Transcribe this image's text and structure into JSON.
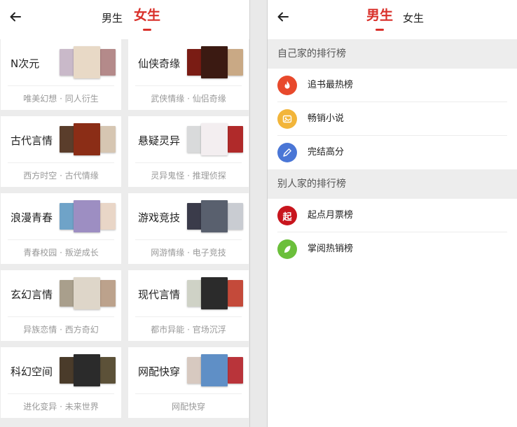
{
  "left": {
    "tabs": {
      "male": "男生",
      "female": "女生"
    },
    "categories": [
      {
        "name": "N次元",
        "tags": "唯美幻想 · 同人衍生",
        "covers": [
          "#c9b9c9",
          "#e8d9c6",
          "#b48a8a"
        ]
      },
      {
        "name": "仙侠奇缘",
        "tags": "武侠情缘 · 仙侣奇缘",
        "covers": [
          "#7a1c14",
          "#3b1a12",
          "#c9a985"
        ]
      },
      {
        "name": "古代言情",
        "tags": "西方时空 · 古代情缘",
        "covers": [
          "#5a3d2b",
          "#8b2d16",
          "#d6c6b2"
        ]
      },
      {
        "name": "悬疑灵异",
        "tags": "灵异鬼怪 · 推理侦探",
        "covers": [
          "#d9dadb",
          "#f3eef0",
          "#b02a2a"
        ]
      },
      {
        "name": "浪漫青春",
        "tags": "青春校园 · 叛逆成长",
        "covers": [
          "#6fa3c8",
          "#9d8ec2",
          "#e9d6c7"
        ]
      },
      {
        "name": "游戏竞技",
        "tags": "网游情缘 · 电子竞技",
        "covers": [
          "#3a3b4a",
          "#59606e",
          "#c9ccd2"
        ]
      },
      {
        "name": "玄幻言情",
        "tags": "异族恋情 · 西方奇幻",
        "covers": [
          "#a99f8c",
          "#ded6c9",
          "#bca28c"
        ]
      },
      {
        "name": "现代言情",
        "tags": "都市异能 · 官场沉浮",
        "covers": [
          "#cfd2c6",
          "#2b2b2b",
          "#c44a3a"
        ]
      },
      {
        "name": "科幻空间",
        "tags": "进化变异 · 未来世界",
        "covers": [
          "#4a3b2a",
          "#2b2b2b",
          "#5c5138"
        ]
      },
      {
        "name": "网配快穿",
        "tags": "网配快穿",
        "covers": [
          "#d7c9c0",
          "#5f8fc6",
          "#b9343a"
        ]
      }
    ]
  },
  "right": {
    "tabs": {
      "male": "男生",
      "female": "女生"
    },
    "sections": [
      {
        "title": "自己家的排行榜",
        "items": [
          {
            "label": "追书最热榜",
            "color": "#e8492c",
            "icon": "flame-icon"
          },
          {
            "label": "畅销小说",
            "color": "#f2b53a",
            "icon": "image-icon"
          },
          {
            "label": "完结高分",
            "color": "#4a76d6",
            "icon": "pen-icon"
          }
        ]
      },
      {
        "title": "别人家的排行榜",
        "items": [
          {
            "label": "起点月票榜",
            "color": "#c8151d",
            "icon": "qidian-icon",
            "glyph": "起"
          },
          {
            "label": "掌阅热销榜",
            "color": "#6bbf3b",
            "icon": "leaf-icon"
          }
        ]
      }
    ]
  },
  "colors": {
    "accent": "#d9302a"
  }
}
